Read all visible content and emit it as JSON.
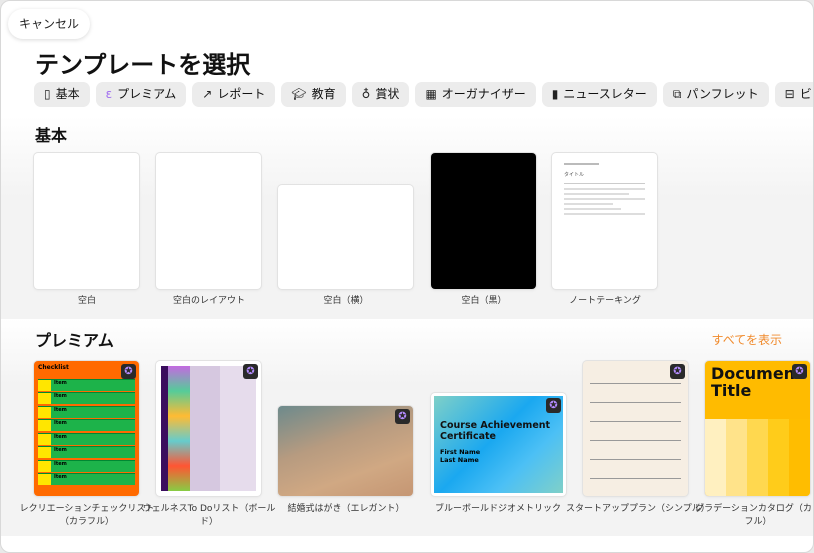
{
  "cancel_label": "キャンセル",
  "title": "テンプレートを選択",
  "chips": [
    {
      "label": "基本",
      "icon": "document-icon"
    },
    {
      "label": "プレミアム",
      "icon": "premium-icon"
    },
    {
      "label": "レポート",
      "icon": "chart-line-icon"
    },
    {
      "label": "教育",
      "icon": "graduation-cap-icon"
    },
    {
      "label": "賞状",
      "icon": "award-icon"
    },
    {
      "label": "オーガナイザー",
      "icon": "calendar-icon"
    },
    {
      "label": "ニュースレター",
      "icon": "newsletter-icon"
    },
    {
      "label": "パンフレット",
      "icon": "brochure-icon"
    },
    {
      "label": "ビ",
      "icon": "briefcase-icon"
    }
  ],
  "basic": {
    "heading": "基本",
    "items": [
      "空白",
      "空白のレイアウト",
      "空白（横）",
      "空白（黒）",
      "ノートテーキング"
    ],
    "note_title": "タイトル"
  },
  "premium": {
    "heading": "プレミアム",
    "see_all": "すべてを表示",
    "items": [
      "レクリエーションチェックリスト（カラフル）",
      "ウェルネスTo Doリスト（ボールド）",
      "結婚式はがき（エレガント）",
      "ブルーボールドジオメトリック",
      "スタートアッププラン（シンプル）",
      "グラデーションカタログ（カラフル）"
    ],
    "checklist_title": "Checklist",
    "checklist_item": "Item",
    "cert_title": "Course Achievement Certificate",
    "cert_name": "First Name Last Name",
    "catalog_title": "Document Title"
  }
}
